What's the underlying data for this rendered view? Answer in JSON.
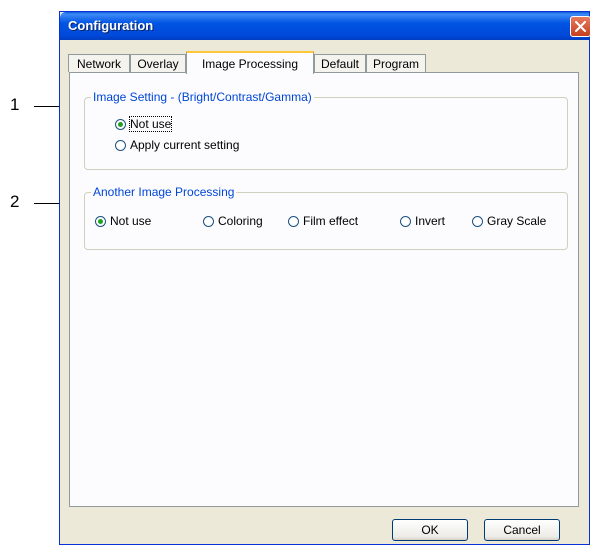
{
  "callouts": {
    "one": "1",
    "two": "2"
  },
  "window": {
    "title": "Configuration"
  },
  "tabs": [
    {
      "label": "Network"
    },
    {
      "label": "Overlay"
    },
    {
      "label": "Image Processing"
    },
    {
      "label": "Default"
    },
    {
      "label": "Program"
    }
  ],
  "active_tab": "Image Processing",
  "image_setting": {
    "legend": "Image Setting - (Bright/Contrast/Gamma)",
    "options": [
      {
        "label": "Not use",
        "checked": true
      },
      {
        "label": "Apply current setting",
        "checked": false
      }
    ]
  },
  "another_processing": {
    "legend": "Another Image Processing",
    "options": [
      {
        "label": "Not use",
        "checked": true
      },
      {
        "label": "Coloring",
        "checked": false
      },
      {
        "label": "Film effect",
        "checked": false
      },
      {
        "label": "Invert",
        "checked": false
      },
      {
        "label": "Gray Scale",
        "checked": false
      }
    ]
  },
  "buttons": {
    "ok": "OK",
    "cancel": "Cancel"
  },
  "colors": {
    "titlebar": "#0054e3",
    "accent_tab": "#ffc83c",
    "legend_text": "#0046d5",
    "radio_dot": "#21a121"
  }
}
